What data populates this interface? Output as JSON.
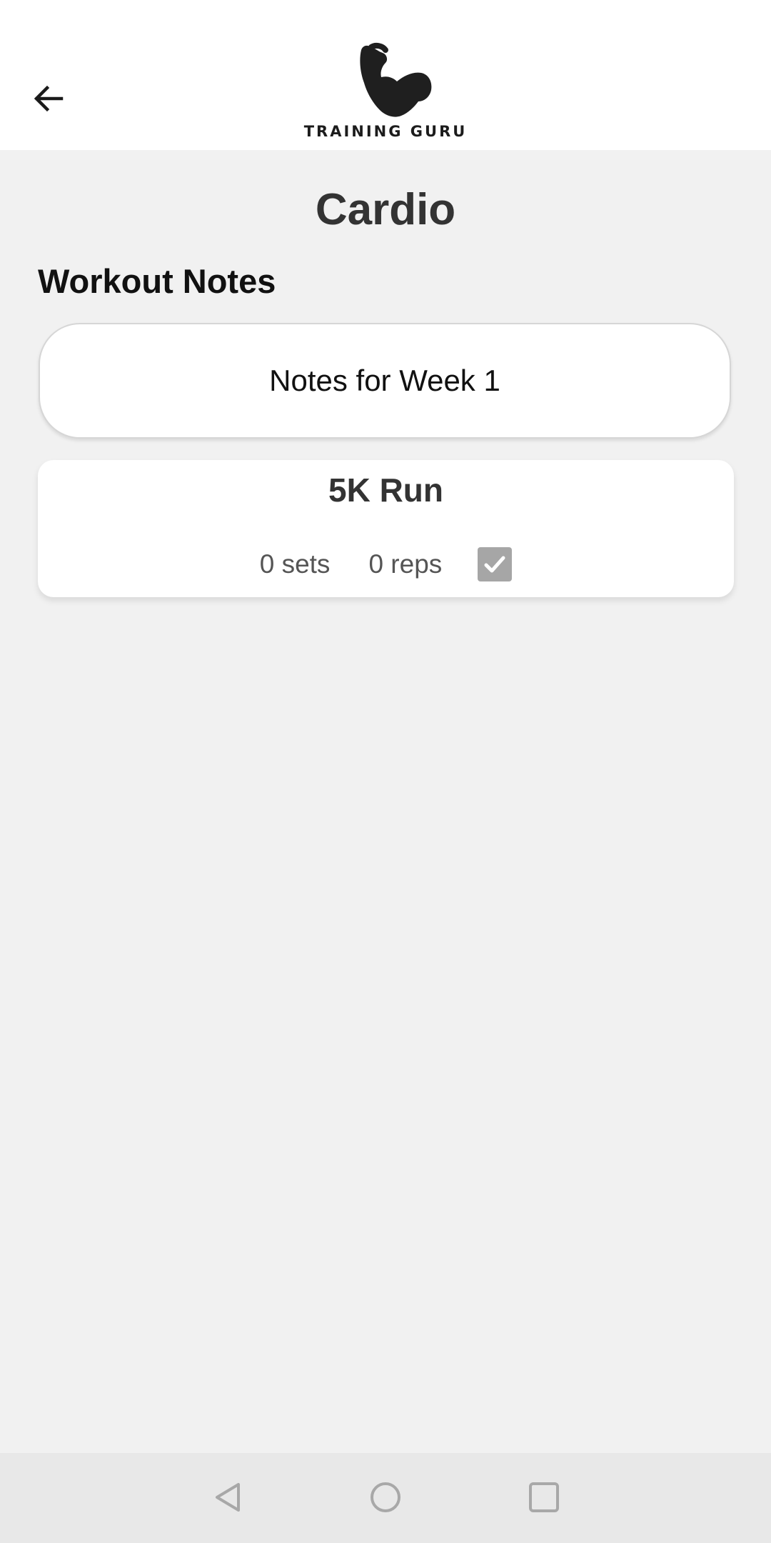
{
  "app": {
    "logo_text": "TRAINING GURU",
    "logo_icon": "flexed-bicep-icon",
    "back_icon": "arrow-left-icon"
  },
  "page": {
    "title": "Cardio",
    "section_title": "Workout Notes"
  },
  "notes_card": {
    "label": "Notes for Week 1"
  },
  "exercises": [
    {
      "name": "5K Run",
      "sets": "0 sets",
      "reps": "0 reps",
      "completed": true,
      "check_icon": "checkmark-icon"
    }
  ],
  "system_nav": {
    "back_icon": "triangle-back-icon",
    "home_icon": "circle-home-icon",
    "recents_icon": "square-recents-icon"
  },
  "colors": {
    "background": "#f1f1f1",
    "card": "#ffffff",
    "checkbox": "#a6a6a6",
    "nav_bar": "#e8e8e8"
  }
}
